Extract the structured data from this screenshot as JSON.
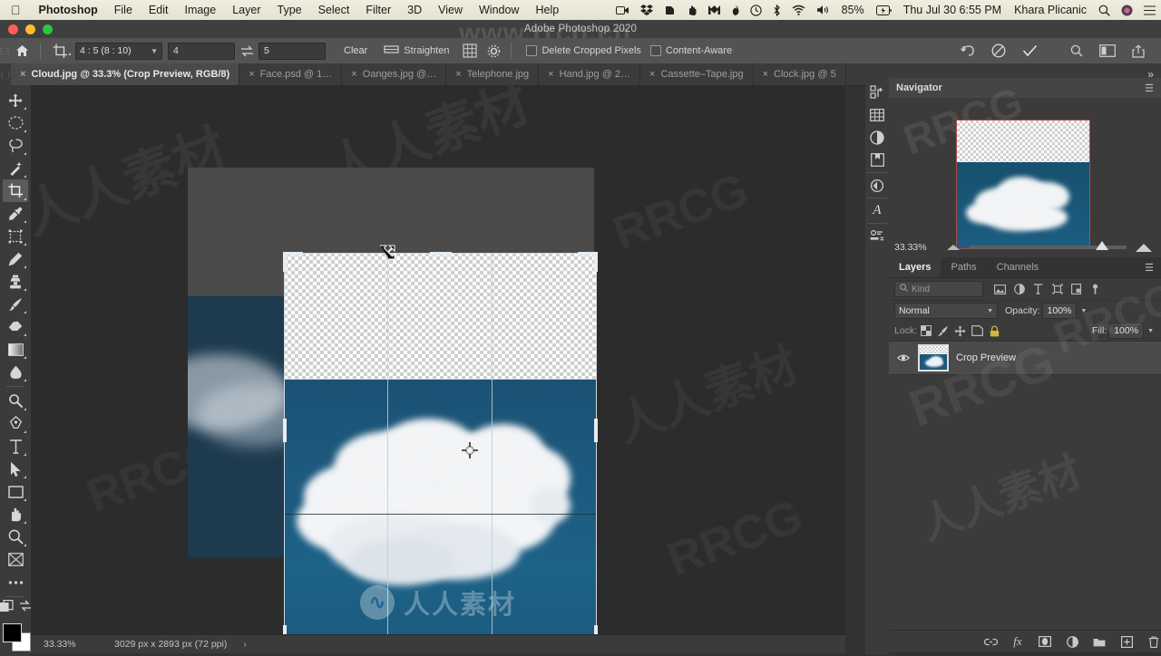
{
  "menubar": {
    "apple_icon": "apple-icon",
    "items": [
      {
        "label": "Photoshop",
        "bold": true
      },
      {
        "label": "File",
        "bold": false
      },
      {
        "label": "Edit",
        "bold": false
      },
      {
        "label": "Image",
        "bold": false
      },
      {
        "label": "Layer",
        "bold": false
      },
      {
        "label": "Type",
        "bold": false
      },
      {
        "label": "Select",
        "bold": false
      },
      {
        "label": "Filter",
        "bold": false
      },
      {
        "label": "3D",
        "bold": false
      },
      {
        "label": "View",
        "bold": false
      },
      {
        "label": "Window",
        "bold": false
      },
      {
        "label": "Help",
        "bold": false
      }
    ],
    "status": {
      "battery": "85%",
      "datetime": "Thu Jul 30  6:55 PM",
      "user": "Khara Plicanic",
      "icons": [
        "screen-recorder-icon",
        "dropbox-icon",
        "evernote-icon",
        "hand-icon",
        "mega-icon",
        "flame-icon",
        "timemachine-icon",
        "bluetooth-icon",
        "wifi-icon",
        "volume-icon",
        "battery-icon",
        "spotlight-search-icon",
        "siri-icon",
        "control-center-icon"
      ]
    }
  },
  "titlebar": {
    "title": "Adobe Photoshop 2020",
    "traffic_lights": [
      "close-button",
      "minimize-button",
      "zoom-button"
    ]
  },
  "options_bar": {
    "home_icon": "home-icon",
    "tool_icon": "crop-tool-icon",
    "ratio_value": "4 : 5 (8 : 10)",
    "width_value": "4",
    "swap_icon": "swap-arrows-icon",
    "height_value": "5",
    "clear_label": "Clear",
    "straighten_icon": "straighten-icon",
    "straighten_label": "Straighten",
    "overlay_icon": "crop-overlay-grid-icon",
    "settings_icon": "gear-icon",
    "delete_cropped_label": "Delete Cropped Pixels",
    "delete_cropped_checked": false,
    "content_aware_label": "Content-Aware",
    "content_aware_checked": false,
    "reset_icon": "reset-icon",
    "cancel_icon": "cancel-icon",
    "commit_icon": "checkmark-icon",
    "search_icon": "search-icon",
    "arrange_icon": "arrange-documents-icon",
    "share_icon": "share-icon"
  },
  "tabs": [
    {
      "label": "Cloud.jpg @ 33.3% (Crop Preview, RGB/8)",
      "active": true
    },
    {
      "label": "Face.psd @ 1…",
      "active": false
    },
    {
      "label": "Oanges.jpg @…",
      "active": false
    },
    {
      "label": "Telephone.jpg",
      "active": false
    },
    {
      "label": "Hand.jpg @ 2…",
      "active": false
    },
    {
      "label": "Cassette–Tape.jpg",
      "active": false
    },
    {
      "label": "Clock.jpg @ 5",
      "active": false
    }
  ],
  "tabs_overflow_icon": "chevron-double-right-icon",
  "toolbar": {
    "tools": [
      {
        "name": "move-tool",
        "glyph": "move-icon",
        "selected": false
      },
      {
        "name": "marquee-tool",
        "glyph": "elliptical-marquee-icon",
        "selected": false
      },
      {
        "name": "lasso-tool",
        "glyph": "lasso-icon",
        "selected": false
      },
      {
        "name": "quick-selection-tool",
        "glyph": "magic-wand-icon",
        "selected": false
      },
      {
        "name": "crop-tool",
        "glyph": "crop-icon",
        "selected": true
      },
      {
        "name": "eyedropper-tool",
        "glyph": "eyedropper-icon",
        "selected": false
      },
      {
        "name": "frame-tool",
        "glyph": "frame-icon",
        "selected": false
      },
      {
        "name": "spot-healing-brush-tool",
        "glyph": "healing-brush-icon",
        "selected": false
      },
      {
        "name": "clone-stamp-tool",
        "glyph": "stamp-icon",
        "selected": false
      },
      {
        "name": "brush-tool",
        "glyph": "brush-icon",
        "selected": false
      },
      {
        "name": "eraser-tool",
        "glyph": "eraser-icon",
        "selected": false
      },
      {
        "name": "gradient-tool",
        "glyph": "gradient-icon",
        "selected": false
      },
      {
        "name": "blur-tool",
        "glyph": "blur-drop-icon",
        "selected": false
      },
      {
        "name": "dodge-tool",
        "glyph": "dodge-icon",
        "selected": false
      },
      {
        "name": "pen-tool",
        "glyph": "pen-icon",
        "selected": false
      },
      {
        "name": "type-tool",
        "glyph": "type-icon",
        "selected": false
      },
      {
        "name": "path-selection-tool",
        "glyph": "path-arrow-icon",
        "selected": false
      },
      {
        "name": "rectangle-tool",
        "glyph": "rectangle-icon",
        "selected": false
      },
      {
        "name": "hand-tool",
        "glyph": "hand-icon",
        "selected": false
      },
      {
        "name": "zoom-tool",
        "glyph": "magnifier-icon",
        "selected": false
      },
      {
        "name": "edit-toolbar",
        "glyph": "edit-toolbar-icon",
        "selected": false
      },
      {
        "name": "more-tools",
        "glyph": "ellipsis-icon",
        "selected": false
      },
      {
        "name": "quick-mask",
        "glyph": "quick-mask-icon",
        "selected": false
      },
      {
        "name": "screen-mode",
        "glyph": "screen-mode-icon",
        "selected": false
      }
    ],
    "foreground_color": "#000000",
    "background_color": "#ffffff"
  },
  "canvas": {
    "document": {
      "transparent_area_color": "#ffffff",
      "sky_color": "#1d5b80",
      "outside_crop_tint": "#2c2c2c"
    },
    "crop_overlay": {
      "rule_of_thirds": true,
      "border_color": "#cfd9e0",
      "center_marker": "crop-center-target-icon",
      "cursor": "crop-corner-resize-cursor"
    },
    "watermark_text": "人人素材",
    "watermark_logo": "site-logo-icon"
  },
  "status_bar": {
    "zoom": "33.33%",
    "doc_info": "3029 px x 2893 px (72 ppi)",
    "expand_icon": "chevron-right-icon"
  },
  "rail_icons": [
    "history-actions-icon",
    "swatches-grid-icon",
    "adjustments-icon",
    "libraries-icon",
    "history-icon",
    "character-icon",
    "properties-icon"
  ],
  "navigator": {
    "title": "Navigator",
    "menu_icon": "panel-menu-icon",
    "zoom_value": "33.33%",
    "zoom_out_icon": "small-mountain-icon",
    "zoom_in_icon": "large-mountain-icon",
    "slider_position_pct": 46
  },
  "layers_panel": {
    "tabs": [
      {
        "label": "Layers",
        "active": true
      },
      {
        "label": "Paths",
        "active": false
      },
      {
        "label": "Channels",
        "active": false
      }
    ],
    "menu_icon": "panel-menu-icon",
    "filter": {
      "search_icon": "search-icon",
      "kind_label": "Kind",
      "icons": [
        "pixel-filter-icon",
        "adjustment-filter-icon",
        "type-filter-icon",
        "shape-filter-icon",
        "smartobject-filter-icon",
        "toggle-filter-icon"
      ]
    },
    "blend_mode": "Normal",
    "opacity_label": "Opacity:",
    "opacity_value": "100%",
    "lock_label": "Lock:",
    "lock_icons": [
      "lock-transparent-pixels-icon",
      "lock-image-pixels-icon",
      "lock-position-icon",
      "lock-artboard-icon",
      "lock-all-icon"
    ],
    "fill_label": "Fill:",
    "fill_value": "100%",
    "layers": [
      {
        "name": "Crop Preview",
        "visible": true,
        "selected": true
      }
    ],
    "footer_icons": [
      "link-layers-icon",
      "fx-icon",
      "layer-mask-icon",
      "adjustment-layer-icon",
      "new-group-icon",
      "new-layer-icon",
      "delete-layer-icon"
    ]
  },
  "watermarks": {
    "brand_cn": "www.rrcg.cn",
    "rrcg": "RRCG",
    "chinese": "人人素材",
    "center_brand": "人人素材"
  }
}
